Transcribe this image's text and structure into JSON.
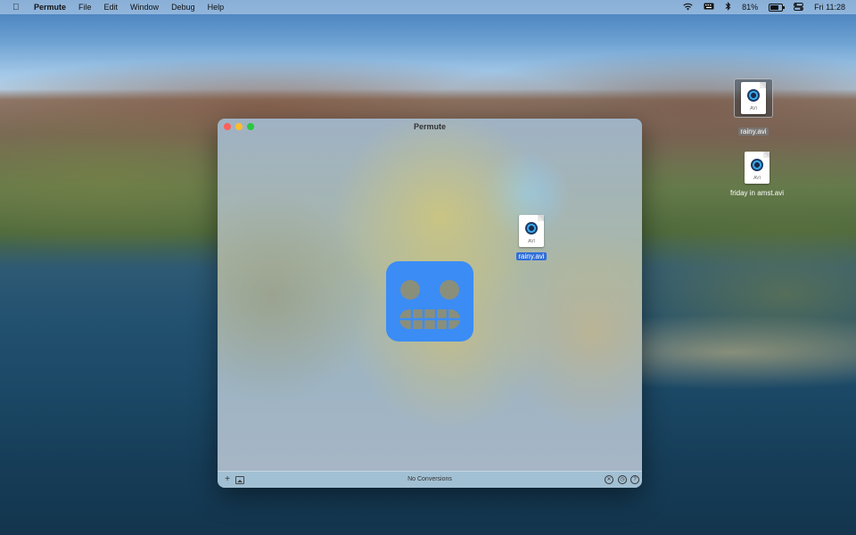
{
  "menubar": {
    "app_name": "Permute",
    "menus": [
      "File",
      "Edit",
      "Window",
      "Debug",
      "Help"
    ],
    "battery_percent": "81%",
    "clock": "Fri 11:28"
  },
  "window": {
    "title": "Permute",
    "status": "No Conversions"
  },
  "dragged_file": {
    "name": "rainy.avi",
    "ext": "AVI"
  },
  "desktop_files": [
    {
      "name": "rainy.avi",
      "ext": "AVI"
    },
    {
      "name": "friday in amst.avi",
      "ext": "AVI"
    }
  ],
  "colors": {
    "accent": "#3b8cf5",
    "selection": "#2f6ed8"
  }
}
